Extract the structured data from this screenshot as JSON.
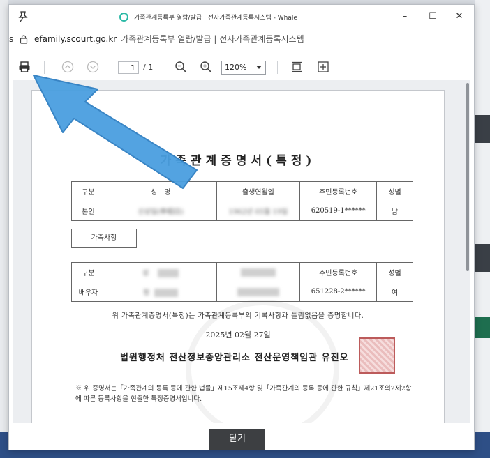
{
  "window": {
    "title": "가족관계등록부 열람/발급 | 전자가족관계등록시스템 - Whale",
    "minimize": "–",
    "maximize": "☐",
    "close": "✕"
  },
  "address": {
    "cut_char": "s",
    "host": "efamily.scourt.go.kr",
    "page_title": "가족관계등록부 열람/발급 | 전자가족관계등록시스템"
  },
  "toolbar": {
    "page_current": "1",
    "page_total": "/ 1",
    "zoom": "120%"
  },
  "certificate": {
    "title": "가족관계증명서(특정)",
    "table1": {
      "headers": [
        "구분",
        "성　명",
        "출생연월일",
        "주민등록번호",
        "성별"
      ],
      "row": [
        "본인",
        "신상일(申相日)",
        "1962년 05월 19일",
        "620519-1******",
        "남"
      ]
    },
    "family_label": "가족사항",
    "table2": {
      "headers": [
        "구분",
        "성",
        "",
        "주민등록번호",
        "성별"
      ],
      "row": [
        "배우자",
        "정",
        "",
        "651228-2******",
        "여"
      ]
    },
    "confirm_text": "위 가족관계증명서(특정)는 가족관계등록부의 기록사항과 틀림없음을 증명합니다.",
    "issue_date": "2025년 02월 27일",
    "issuer": "법원행정처 전산정보중앙관리소 전산운영책임관 유진오",
    "footnote": "※ 위 증명서는「가족관계의 등록 등에 관한 법률」제15조제4항 및「가족관계의 등록 등에 관한 규칙」제21조의2제2항에 따른 등록사항을 현출한 특정증명서입니다."
  },
  "footer": {
    "close_label": "닫기"
  },
  "colors": {
    "arrow": "#4a9fe0",
    "accent_tab": "#2bb9a6",
    "taskbar": "#2e4f86"
  }
}
